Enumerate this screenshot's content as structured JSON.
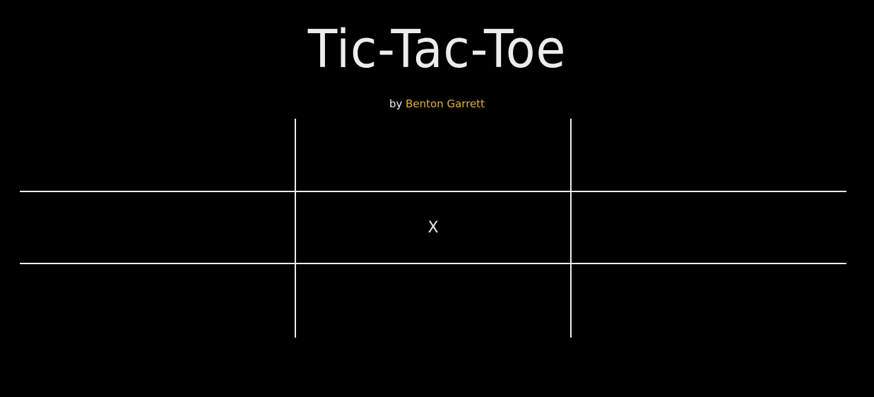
{
  "title": "Tic-Tac-Toe",
  "byline": {
    "prefix": "by",
    "author": "Benton Garrett"
  },
  "colors": {
    "background": "#000000",
    "text": "#ececec",
    "accent": "#e8b41c",
    "grid": "#ececec"
  },
  "board": {
    "cells": [
      [
        "",
        "",
        ""
      ],
      [
        "",
        "X",
        ""
      ],
      [
        "",
        "",
        ""
      ]
    ]
  }
}
